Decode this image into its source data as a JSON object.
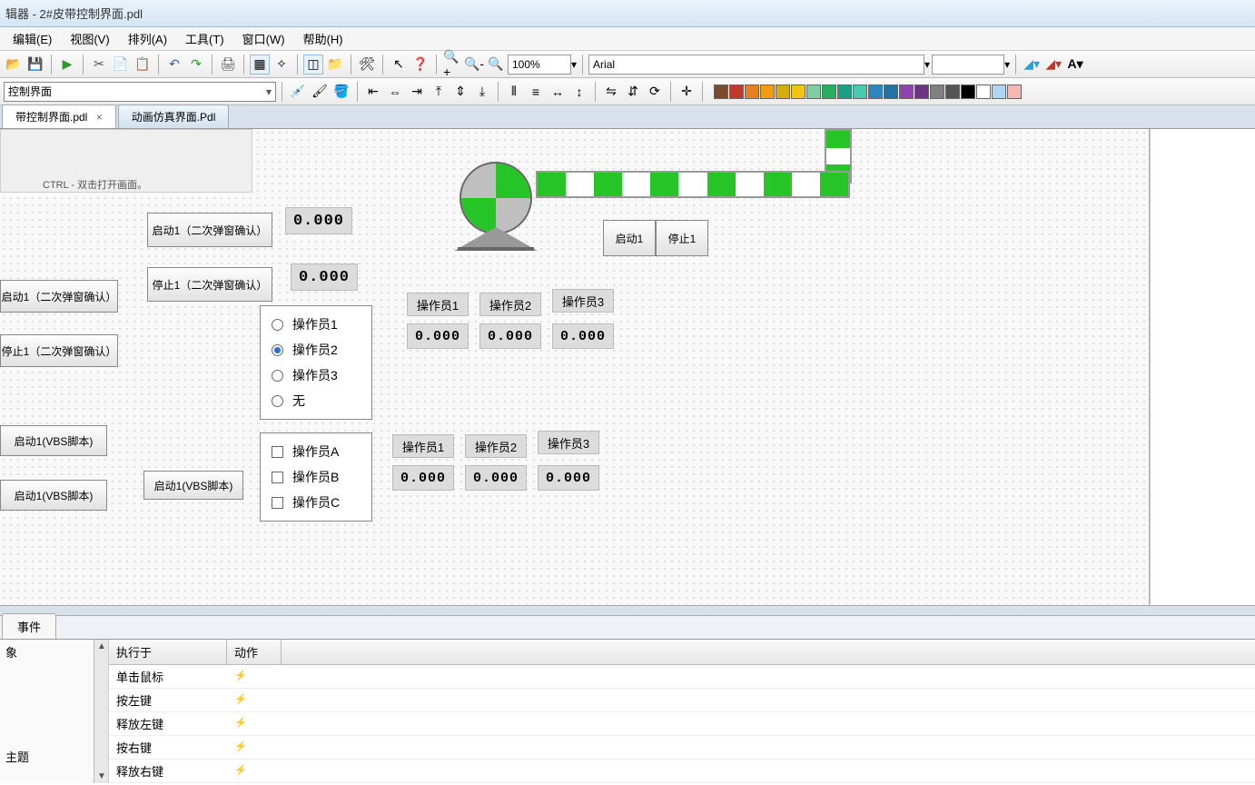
{
  "title": "辑器 - 2#皮带控制界面.pdl",
  "menu": {
    "edit": "编辑(E)",
    "view": "视图(V)",
    "arrange": "排列(A)",
    "tools": "工具(T)",
    "window": "窗口(W)",
    "help": "帮助(H)"
  },
  "toolbar1": {
    "zoom": "100%",
    "font": "Arial",
    "fontsize": ""
  },
  "toolbar2": {
    "combo_label": "控制界面"
  },
  "palette": [
    "#7a4a2a",
    "#c0392b",
    "#e67e22",
    "#f39c12",
    "#d4ac0d",
    "#f1c40f",
    "#7dcea0",
    "#27ae60",
    "#16a085",
    "#48c9b0",
    "#2e86c1",
    "#2471a3",
    "#8e44ad",
    "#6c3483",
    "#808080",
    "#555555",
    "#000000",
    "#ffffff",
    "#aed6f1",
    "#f5b7b1"
  ],
  "tabs": {
    "active": "带控制界面.pdl",
    "other": "动画仿真界面.Pdl"
  },
  "canvas": {
    "hint": "CTRL - 双击打开画面。",
    "btn_start1_confirm": "启动1（二次弹窗确认）",
    "btn_stop1_confirm": "停止1（二次弹窗确认）",
    "btn_start1_confirm_b": "启动1（二次弹窗确认）",
    "btn_stop1_confirm_b": "停止1（二次弹窗确认）",
    "btn_start_vbs_a": "启动1(VBS脚本)",
    "btn_start_vbs_b": "启动1(VBS脚本)",
    "btn_start_vbs_c": "启动1(VBS脚本)",
    "val1": "0.000",
    "val2": "0.000",
    "btn_start1": "启动1",
    "btn_stop1": "停止1",
    "radios": {
      "r1": "操作员1",
      "r2": "操作员2",
      "r3": "操作员3",
      "r4": "无",
      "selected": 2
    },
    "checks": {
      "c1": "操作员A",
      "c2": "操作员B",
      "c3": "操作员C"
    },
    "op_labels_a": {
      "l1": "操作员1",
      "l2": "操作员2",
      "l3": "操作员3",
      "v1": "0.000",
      "v2": "0.000",
      "v3": "0.000"
    },
    "op_labels_b": {
      "l1": "操作员1",
      "l2": "操作员2",
      "l3": "操作员3",
      "v1": "0.000",
      "v2": "0.000",
      "v3": "0.000"
    }
  },
  "bottom": {
    "tab_events": "事件",
    "left_items": {
      "i1": "象",
      "i2": "",
      "i3": "主题"
    },
    "cols": {
      "exec": "执行于",
      "act": "动作"
    },
    "rows": {
      "r1": "单击鼠标",
      "r2": "按左键",
      "r3": "释放左键",
      "r4": "按右键",
      "r5": "释放右键"
    }
  }
}
